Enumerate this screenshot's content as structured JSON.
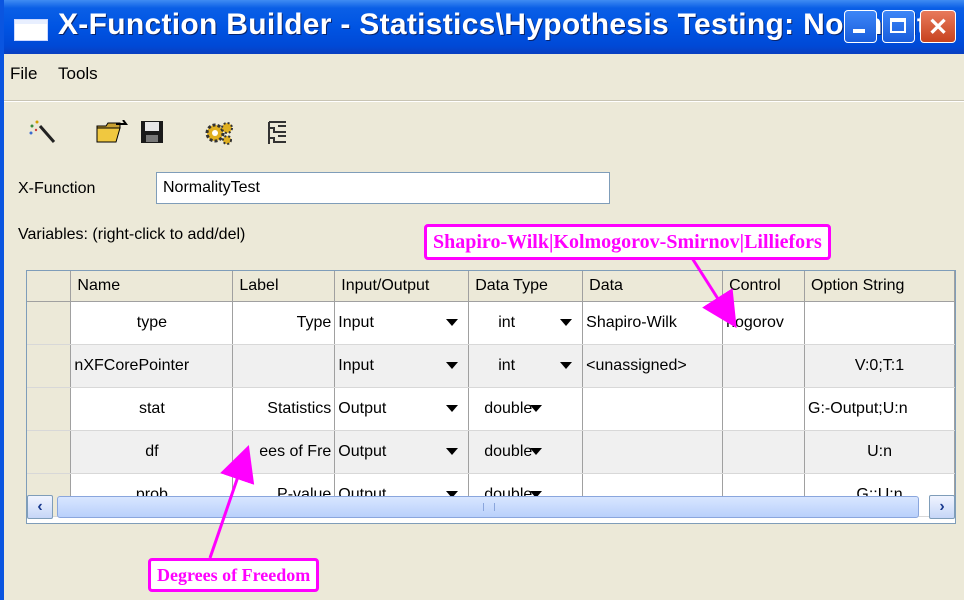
{
  "window": {
    "title": "X-Function Builder - Statistics\\Hypothesis Testing: Normalit…",
    "minimize_symbol": "",
    "close_symbol": "✕"
  },
  "menu": {
    "file": "File",
    "tools": "Tools"
  },
  "toolbar": {
    "icons": [
      "wand-icon",
      "open-folder-icon",
      "save-icon",
      "gear-icon",
      "tree-icon"
    ]
  },
  "form": {
    "xfunction_label": "X-Function",
    "xfunction_value": "NormalityTest",
    "variables_label": "Variables: (right-click to add/del)"
  },
  "table": {
    "columns": [
      "Name",
      "Label",
      "Input/Output",
      "Data Type",
      "Data",
      "Control",
      "Option String"
    ],
    "rows": [
      {
        "name": "type",
        "label": "Type",
        "io": "Input",
        "dtype": "int",
        "data": "Shapiro-Wilk",
        "control": "nogorov",
        "option": ""
      },
      {
        "name": "nXFCorePointer",
        "label": "",
        "io": "Input",
        "dtype": "int",
        "data": "<unassigned>",
        "control": "",
        "option": "V:0;T:1"
      },
      {
        "name": "stat",
        "label": "Statistics",
        "io": "Output",
        "dtype": "double",
        "data": "",
        "control": "",
        "option": "G:-Output;U:n"
      },
      {
        "name": "df",
        "label": "ees of Fre",
        "io": "Output",
        "dtype": "double",
        "data": "",
        "control": "",
        "option": "U:n"
      },
      {
        "name": "prob",
        "label": "P-value",
        "io": "Output",
        "dtype": "double",
        "data": "",
        "control": "",
        "option": "G:;U:n"
      }
    ]
  },
  "scrollbar": {
    "left_arrow": "‹",
    "right_arrow": "›"
  },
  "annotations": {
    "control_note": "Shapiro-Wilk|Kolmogorov-Smirnov|Lilliefors",
    "label_note": "Degrees of Freedom",
    "color": "#ff00ff"
  }
}
